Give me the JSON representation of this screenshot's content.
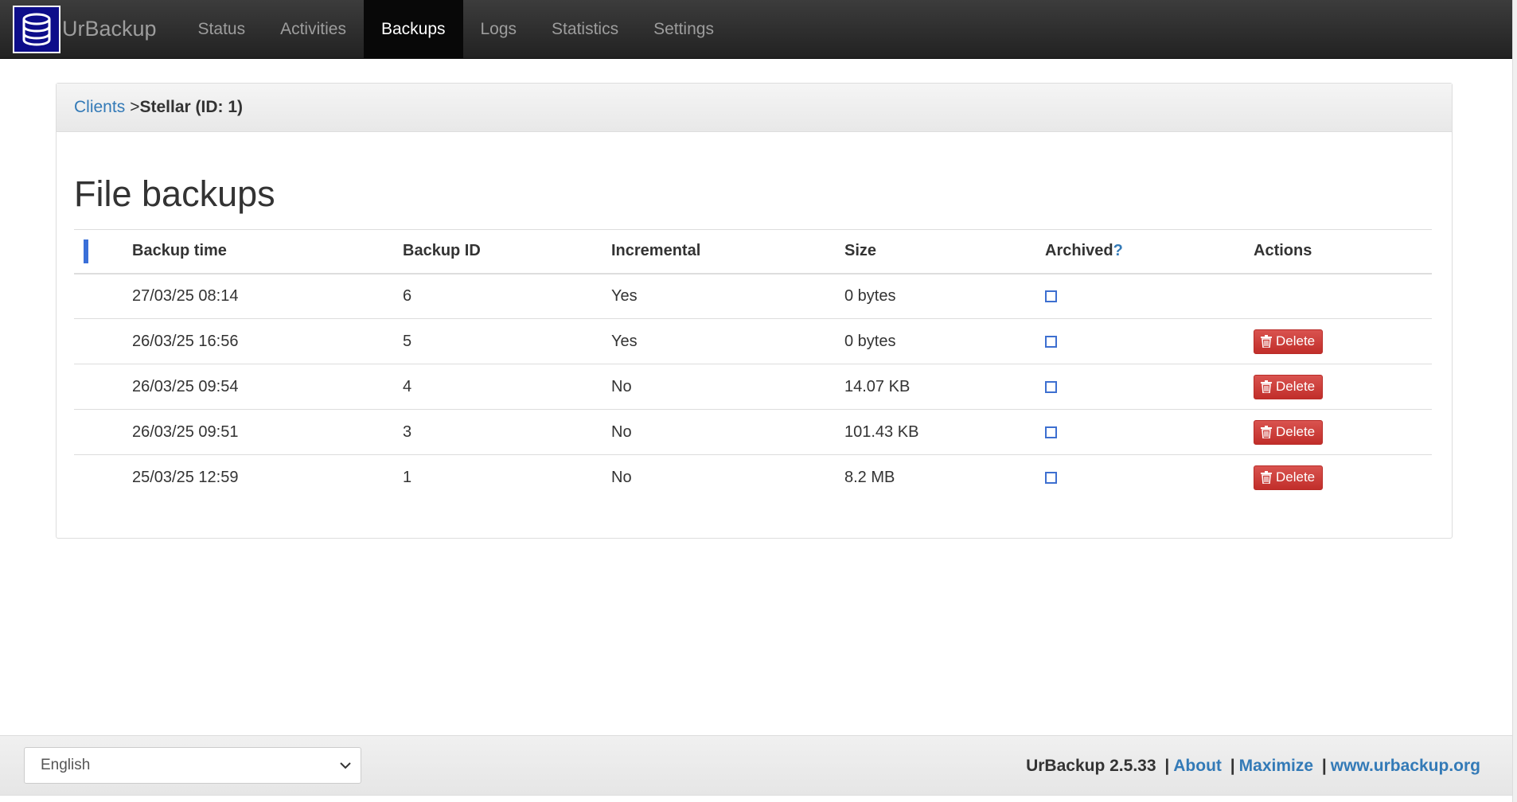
{
  "navbar": {
    "brand": "UrBackup",
    "items": [
      {
        "label": "Status",
        "active": false
      },
      {
        "label": "Activities",
        "active": false
      },
      {
        "label": "Backups",
        "active": true
      },
      {
        "label": "Logs",
        "active": false
      },
      {
        "label": "Statistics",
        "active": false
      },
      {
        "label": "Settings",
        "active": false
      }
    ]
  },
  "breadcrumb": {
    "link": "Clients",
    "separator": ">",
    "current": "Stellar (ID: 1)"
  },
  "section_title": "File backups",
  "table": {
    "headers": {
      "time": "Backup time",
      "id": "Backup ID",
      "incremental": "Incremental",
      "size": "Size",
      "archived": "Archived",
      "archived_help": "?",
      "actions": "Actions"
    },
    "rows": [
      {
        "time": "27/03/25 08:14",
        "id": "6",
        "incremental": "Yes",
        "size": "0 bytes",
        "archived": false,
        "delete": ""
      },
      {
        "time": "26/03/25 16:56",
        "id": "5",
        "incremental": "Yes",
        "size": "0 bytes",
        "archived": false,
        "delete": "Delete"
      },
      {
        "time": "26/03/25 09:54",
        "id": "4",
        "incremental": "No",
        "size": "14.07 KB",
        "archived": false,
        "delete": "Delete"
      },
      {
        "time": "26/03/25 09:51",
        "id": "3",
        "incremental": "No",
        "size": "101.43 KB",
        "archived": false,
        "delete": "Delete"
      },
      {
        "time": "25/03/25 12:59",
        "id": "1",
        "incremental": "No",
        "size": "8.2 MB",
        "archived": false,
        "delete": "Delete"
      }
    ]
  },
  "footer": {
    "language": "English",
    "version": "UrBackup 2.5.33",
    "separator": "|",
    "about": "About",
    "maximize": "Maximize",
    "website": "www.urbackup.org"
  },
  "colors": {
    "navbar_bg": "#222222",
    "link": "#337ab7",
    "delete_button": "#d9534f",
    "marker": "#3a6fd8"
  }
}
